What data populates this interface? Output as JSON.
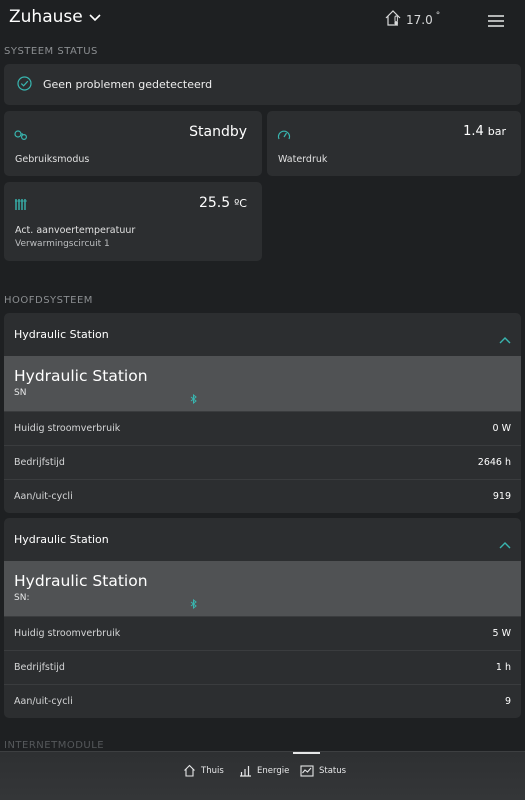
{
  "header": {
    "title": "Zuhause",
    "outside_temp": "17.0",
    "degree": "°"
  },
  "system_status": {
    "section_label": "SYSTEEM STATUS",
    "ok_text": "Geen problemen gedetecteerd",
    "accent_color": "#38b6b0"
  },
  "tiles": {
    "mode": {
      "value": "Standby",
      "label": "Gebruiksmodus",
      "icon": "operating-mode-icon"
    },
    "pressure": {
      "value": "1.4",
      "unit": "bar",
      "label": "Waterdruk",
      "icon": "gauge-icon"
    },
    "supply_temp": {
      "value": "25.5",
      "unit": "ºC",
      "label": "Act. aanvoertemperatuur",
      "sublabel": "Verwarmingscircuit 1",
      "icon": "radiator-icon"
    }
  },
  "main_system": {
    "section_label": "HOOFDSYSTEEM",
    "stations": [
      {
        "header": "Hydraulic Station",
        "title": "Hydraulic Station",
        "sn": "SN",
        "rows": [
          {
            "label": "Huidig stroomverbruik",
            "value": "0 W"
          },
          {
            "label": "Bedrijfstijd",
            "value": "2646 h"
          },
          {
            "label": "Aan/uit-cycli",
            "value": "919"
          }
        ]
      },
      {
        "header": "Hydraulic Station",
        "title": "Hydraulic Station",
        "sn": "SN:",
        "rows": [
          {
            "label": "Huidig stroomverbruik",
            "value": "5 W"
          },
          {
            "label": "Bedrijfstijd",
            "value": "1 h"
          },
          {
            "label": "Aan/uit-cycli",
            "value": "9"
          }
        ]
      }
    ]
  },
  "next_section_label": "INTERNETMODULE",
  "tabbar": {
    "tabs": [
      {
        "label": "Thuis",
        "icon": "home-icon"
      },
      {
        "label": "Energie",
        "icon": "bar-chart-icon"
      },
      {
        "label": "Status",
        "icon": "status-chart-icon",
        "active": true
      }
    ]
  }
}
